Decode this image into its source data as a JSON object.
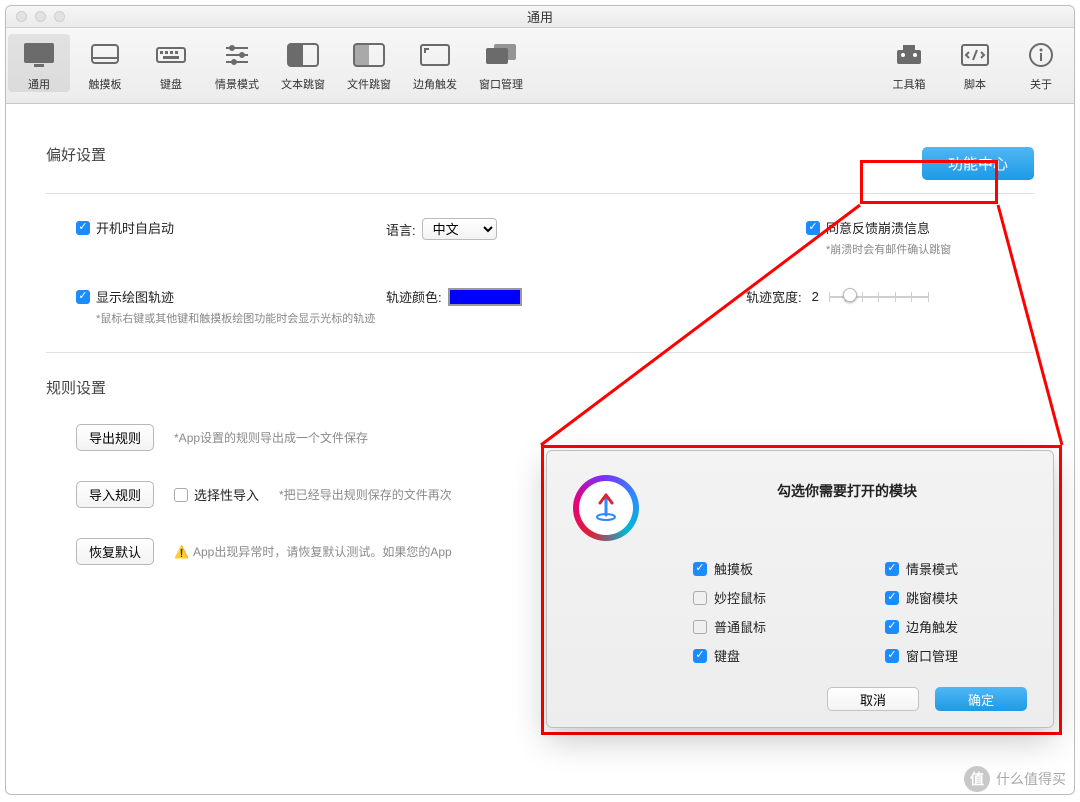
{
  "window": {
    "title": "通用"
  },
  "toolbar": {
    "items": [
      {
        "key": "general",
        "label": "通用",
        "selected": true
      },
      {
        "key": "trackpad",
        "label": "触摸板",
        "selected": false
      },
      {
        "key": "keyboard",
        "label": "键盘",
        "selected": false
      },
      {
        "key": "scene",
        "label": "情景模式",
        "selected": false
      },
      {
        "key": "textpop",
        "label": "文本跳窗",
        "selected": false
      },
      {
        "key": "filepop",
        "label": "文件跳窗",
        "selected": false
      },
      {
        "key": "corner",
        "label": "边角触发",
        "selected": false
      },
      {
        "key": "winmgr",
        "label": "窗口管理",
        "selected": false
      }
    ],
    "right": [
      {
        "key": "toolbox",
        "label": "工具箱"
      },
      {
        "key": "script",
        "label": "脚本"
      },
      {
        "key": "about",
        "label": "关于"
      }
    ]
  },
  "prefs": {
    "section_title": "偏好设置",
    "feature_center_btn": "功能中心",
    "launch_at_login": {
      "label": "开机时自启动",
      "checked": true
    },
    "language_label": "语言:",
    "language_value": "中文",
    "crash_feedback": {
      "label": "同意反馈崩溃信息",
      "checked": true,
      "hint": "*崩溃时会有邮件确认跳窗"
    },
    "show_track": {
      "label": "显示绘图轨迹",
      "checked": true,
      "hint": "*鼠标右键或其他键和触摸板绘图功能时会显示光标的轨迹"
    },
    "track_color_label": "轨迹颜色:",
    "track_color_value": "#0000ff",
    "track_width_label": "轨迹宽度:",
    "track_width_value": "2"
  },
  "rules": {
    "section_title": "规则设置",
    "export_btn": "导出规则",
    "export_desc": "*App设置的规则导出成一个文件保存",
    "import_btn": "导入规则",
    "selective_label": "选择性导入",
    "selective_checked": false,
    "import_desc": "*把已经导出规则保存的文件再次",
    "restore_btn": "恢复默认",
    "restore_desc": "App出现异常时，请恢复默认测试。如果您的App"
  },
  "modal": {
    "title": "勾选你需要打开的模块",
    "left": [
      {
        "label": "触摸板",
        "checked": true
      },
      {
        "label": "妙控鼠标",
        "checked": false
      },
      {
        "label": "普通鼠标",
        "checked": false
      },
      {
        "label": "键盘",
        "checked": true
      }
    ],
    "right": [
      {
        "label": "情景模式",
        "checked": true
      },
      {
        "label": "跳窗模块",
        "checked": true
      },
      {
        "label": "边角触发",
        "checked": true
      },
      {
        "label": "窗口管理",
        "checked": true
      }
    ],
    "cancel": "取消",
    "ok": "确定"
  },
  "watermark": {
    "badge": "值",
    "text": "什么值得买"
  }
}
